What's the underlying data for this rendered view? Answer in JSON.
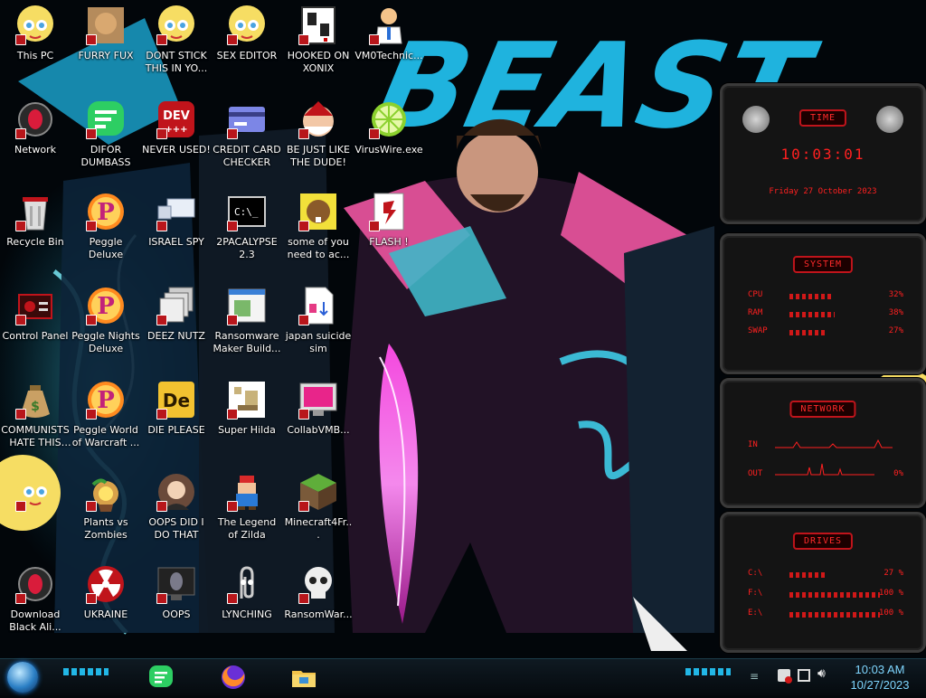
{
  "desktop": {
    "icons": [
      {
        "label": "This PC",
        "icon": "star-character-icon",
        "col": 0,
        "row": 0
      },
      {
        "label": "FURRY FUX",
        "icon": "furry-image-icon",
        "col": 1,
        "row": 0
      },
      {
        "label": "DONT STICK THIS IN YO...",
        "icon": "star-character-icon",
        "col": 2,
        "row": 0
      },
      {
        "label": "SEX EDITOR",
        "icon": "star-character-icon",
        "col": 3,
        "row": 0
      },
      {
        "label": "HOOKED ON XONIX",
        "icon": "xonix-game-icon",
        "col": 4,
        "row": 0
      },
      {
        "label": "VM0Technic...",
        "icon": "doctor-icon",
        "col": 5,
        "row": 0
      },
      {
        "label": "Network",
        "icon": "alienware-network-icon",
        "col": 0,
        "row": 1
      },
      {
        "label": "DIFOR DUMBASS",
        "icon": "green-chat-icon",
        "col": 1,
        "row": 1
      },
      {
        "label": "NEVER USED!",
        "icon": "dev-plus-icon",
        "col": 2,
        "row": 1
      },
      {
        "label": "CREDIT CARD CHECKER",
        "icon": "credit-card-icon",
        "col": 3,
        "row": 1
      },
      {
        "label": "BE JUST LIKE THE DUDE!",
        "icon": "santa-face-icon",
        "col": 4,
        "row": 1
      },
      {
        "label": "VirusWire.exe",
        "icon": "lime-icon",
        "col": 5,
        "row": 1
      },
      {
        "label": "Recycle Bin",
        "icon": "recycle-bin-icon",
        "col": 0,
        "row": 2
      },
      {
        "label": "Peggle Deluxe",
        "icon": "peggle-icon",
        "col": 1,
        "row": 2
      },
      {
        "label": "ISRAEL SPY",
        "icon": "network-monitor-icon",
        "col": 2,
        "row": 2
      },
      {
        "label": "2PACALYPSE 2.3",
        "icon": "terminal-icon",
        "col": 3,
        "row": 2
      },
      {
        "label": "some of you need to ac...",
        "icon": "beaver-icon",
        "col": 4,
        "row": 2
      },
      {
        "label": "FLASH !",
        "icon": "flash-icon",
        "col": 5,
        "row": 2
      },
      {
        "label": "Control Panel",
        "icon": "control-panel-icon",
        "col": 0,
        "row": 3
      },
      {
        "label": "Peggle Nights Deluxe",
        "icon": "peggle-icon",
        "col": 1,
        "row": 3
      },
      {
        "label": "DEEZ NUTZ",
        "icon": "windows-stack-icon",
        "col": 2,
        "row": 3
      },
      {
        "label": "Ransomware Maker Build...",
        "icon": "installer-window-icon",
        "col": 3,
        "row": 3
      },
      {
        "label": "japan suicide sim",
        "icon": "document-icon",
        "col": 4,
        "row": 3
      },
      {
        "label": "COMMUNISTS HATE THIS G...",
        "icon": "money-bag-icon",
        "col": 0,
        "row": 4
      },
      {
        "label": "Peggle World of Warcraft ...",
        "icon": "peggle-icon",
        "col": 1,
        "row": 4
      },
      {
        "label": "DIE PLEASE",
        "icon": "de-icon",
        "col": 2,
        "row": 4
      },
      {
        "label": "Super Hilda",
        "icon": "pixel-dog-icon",
        "col": 3,
        "row": 4
      },
      {
        "label": "CollabVMB...",
        "icon": "collabvm-icon",
        "col": 4,
        "row": 4
      },
      {
        "label": "",
        "icon": "star-character-icon",
        "col": 0,
        "row": 5
      },
      {
        "label": "Plants vs Zombies",
        "icon": "plant-icon",
        "col": 1,
        "row": 5
      },
      {
        "label": "OOPS DID I DO THAT",
        "icon": "portrait-icon",
        "col": 2,
        "row": 5
      },
      {
        "label": "The Legend of Zilda",
        "icon": "pixel-hero-icon",
        "col": 3,
        "row": 5
      },
      {
        "label": "Minecraft4Fr...",
        "icon": "grass-block-icon",
        "col": 4,
        "row": 5
      },
      {
        "label": "Download Black Ali...",
        "icon": "alienware-red-icon",
        "col": 0,
        "row": 6
      },
      {
        "label": "UKRAINE",
        "icon": "radiation-icon",
        "col": 1,
        "row": 6
      },
      {
        "label": "OOPS",
        "icon": "monitor-alien-icon",
        "col": 2,
        "row": 6
      },
      {
        "label": "LYNCHING",
        "icon": "clippy-icon",
        "col": 3,
        "row": 6
      },
      {
        "label": "RansomWar...",
        "icon": "skull-icon",
        "col": 4,
        "row": 6
      }
    ]
  },
  "gadgets": {
    "time": {
      "title": "TIME",
      "clock": "10:03:01",
      "date": "Friday 27 October 2023"
    },
    "system": {
      "title": "SYSTEM",
      "rows": [
        {
          "key": "CPU",
          "value": "32%",
          "fill": 0.32
        },
        {
          "key": "RAM",
          "value": "38%",
          "fill": 0.38
        },
        {
          "key": "SWAP",
          "value": "27%",
          "fill": 0.27
        }
      ]
    },
    "network": {
      "title": "NETWORK",
      "in_label": "IN",
      "out_label": "OUT",
      "out_value": "0%"
    },
    "drives": {
      "title": "DRIVES",
      "rows": [
        {
          "key": "C:\\",
          "value": "27 %",
          "fill": 0.27
        },
        {
          "key": "F:\\",
          "value": "100 %",
          "fill": 1.0
        },
        {
          "key": "E:\\",
          "value": "100 %",
          "fill": 1.0
        }
      ]
    }
  },
  "taskbar": {
    "start_icon": "start-orb-icon",
    "pinned": [
      {
        "name": "green-chat-icon"
      },
      {
        "name": "firefox-icon"
      },
      {
        "name": "file-explorer-icon"
      }
    ],
    "tray": {
      "time": "10:03 AM",
      "date": "10/27/2023"
    }
  },
  "wallpaper": {
    "text": "BEAST"
  },
  "colors": {
    "accent_red": "#ff2020",
    "wallpaper_cyan": "#19b7e8",
    "magenta": "#e0218a"
  }
}
